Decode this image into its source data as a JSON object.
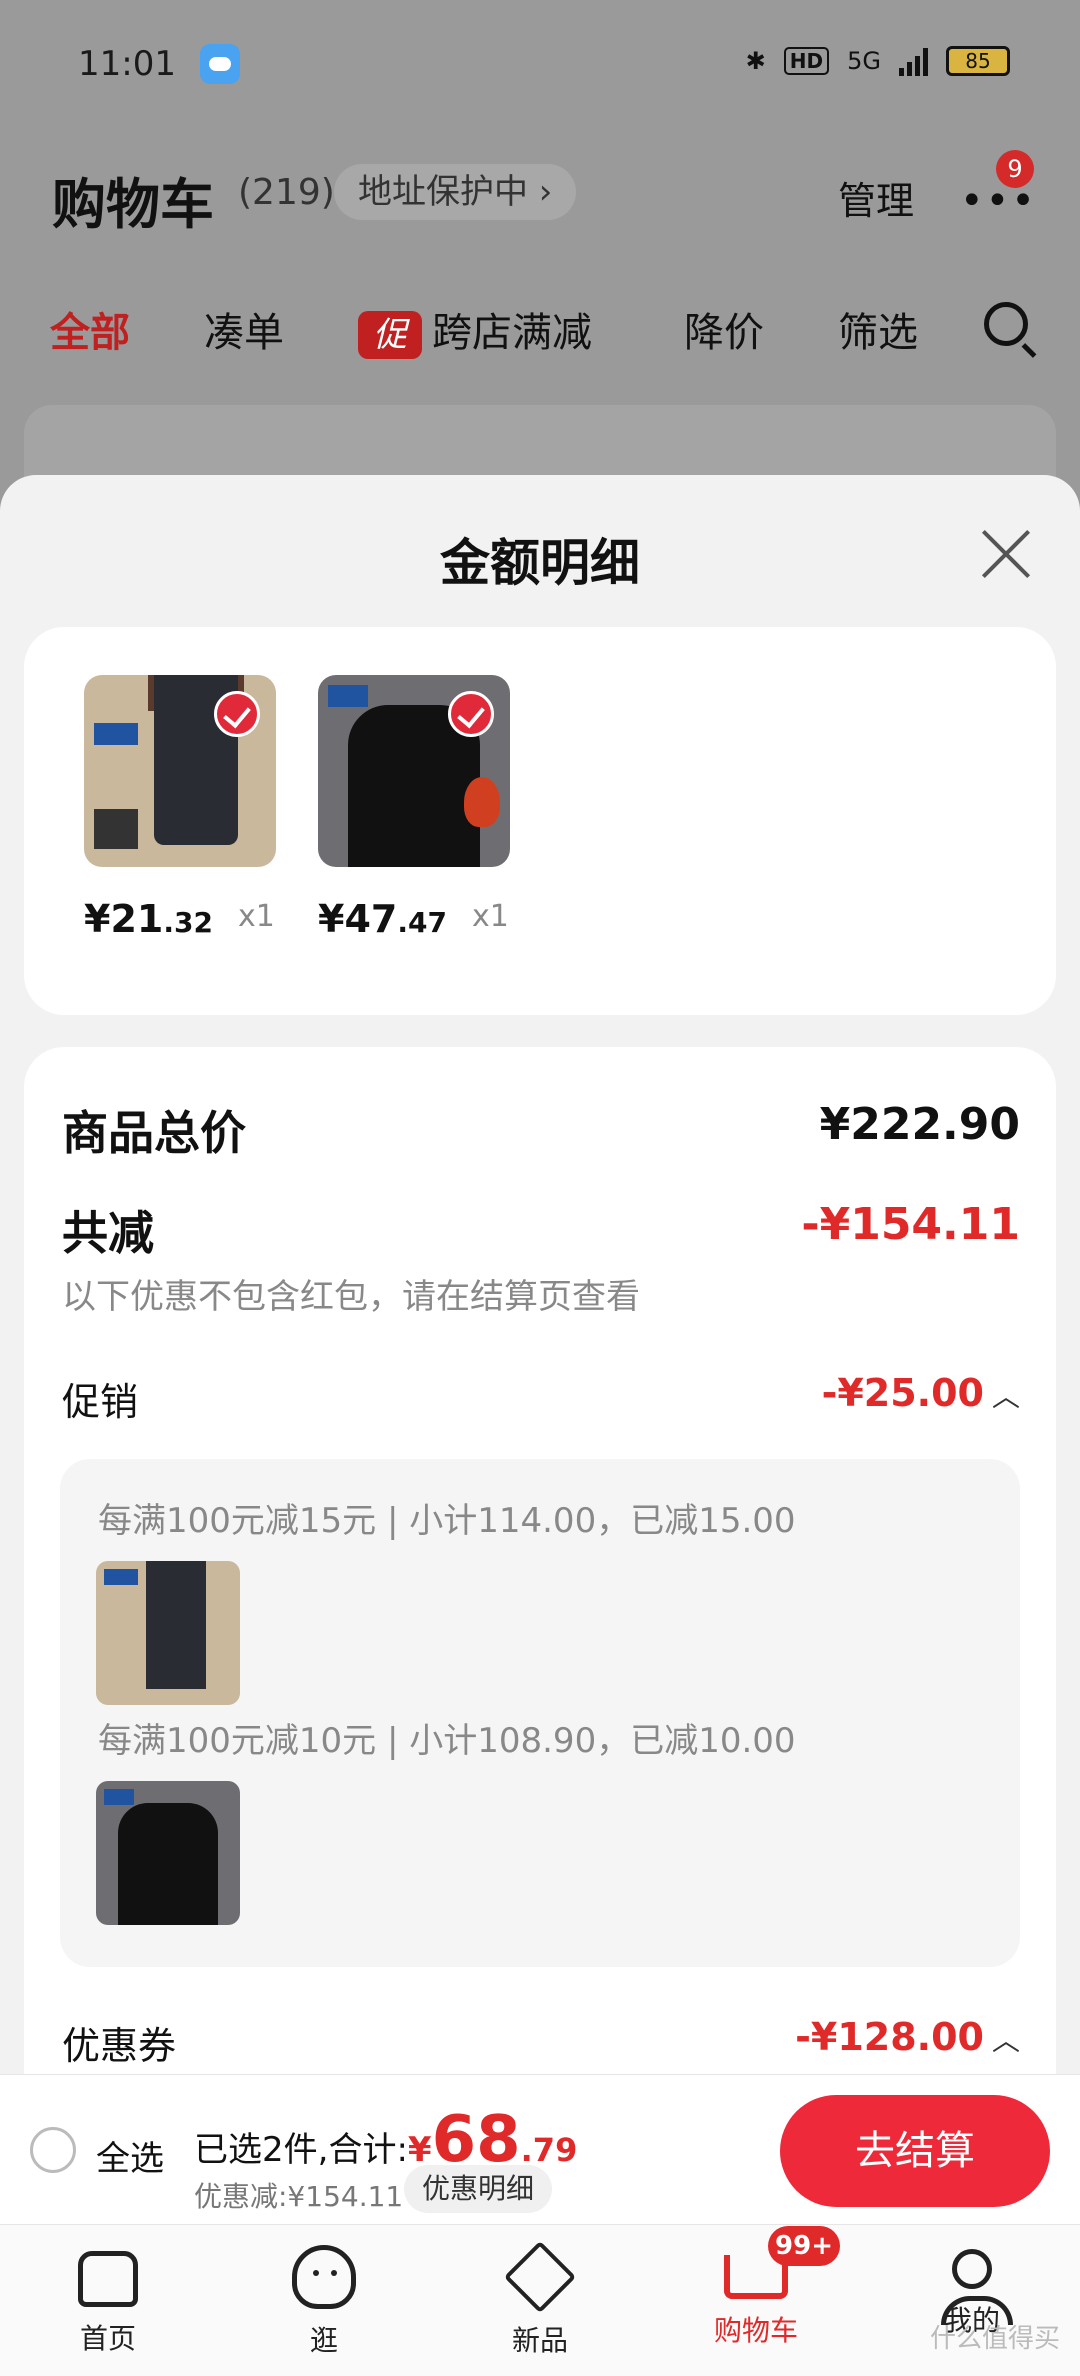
{
  "status_bar": {
    "time": "11:01",
    "network": "5G",
    "hd": "HD",
    "battery": "85"
  },
  "header": {
    "title": "购物车",
    "count": "(219)",
    "address_protect": "地址保护中 ›",
    "manage": "管理",
    "more_badge": "9"
  },
  "tabs": [
    {
      "label": "全部"
    },
    {
      "label": "凑单"
    },
    {
      "label": "跨店满减",
      "tag": "促"
    },
    {
      "label": "降价"
    },
    {
      "label": "筛选"
    }
  ],
  "sheet": {
    "title": "金额明细",
    "items": [
      {
        "price_int": "¥21",
        "price_dec": ".32",
        "qty": "x1"
      },
      {
        "price_int": "¥47",
        "price_dec": ".47",
        "qty": "x1"
      }
    ],
    "total_label": "商品总价",
    "total_value": "¥222.90",
    "reduce_label": "共减",
    "reduce_value": "-¥154.11",
    "reduce_note": "以下优惠不包含红包，请在结算页查看",
    "promo_label": "促销",
    "promo_value": "-¥25.00",
    "promo_lines": [
      "每满100元减15元 | 小计114.00，已减15.00",
      "每满100元减10元 | 小计108.90，已减10.00"
    ],
    "coupon_label": "优惠券",
    "coupon_value": "-¥128.00"
  },
  "bottom_bar": {
    "select_all": "全选",
    "selected_prefix": "已选2件,合计:",
    "yen": "¥",
    "total_int": "68",
    "total_dec": ".79",
    "discount": "优惠减:¥154.11",
    "detail_chip": "优惠明细",
    "checkout": "去结算"
  },
  "nav": [
    {
      "label": "首页",
      "icon": "home-icon"
    },
    {
      "label": "逛",
      "icon": "browse-icon"
    },
    {
      "label": "新品",
      "icon": "box-icon"
    },
    {
      "label": "购物车",
      "icon": "cart-icon",
      "badge": "99+"
    },
    {
      "label": "我的",
      "icon": "user-icon"
    }
  ],
  "watermark": "什么值得买",
  "colors": {
    "accent": "#e02a2a",
    "checkout": "#ee2a3a"
  }
}
